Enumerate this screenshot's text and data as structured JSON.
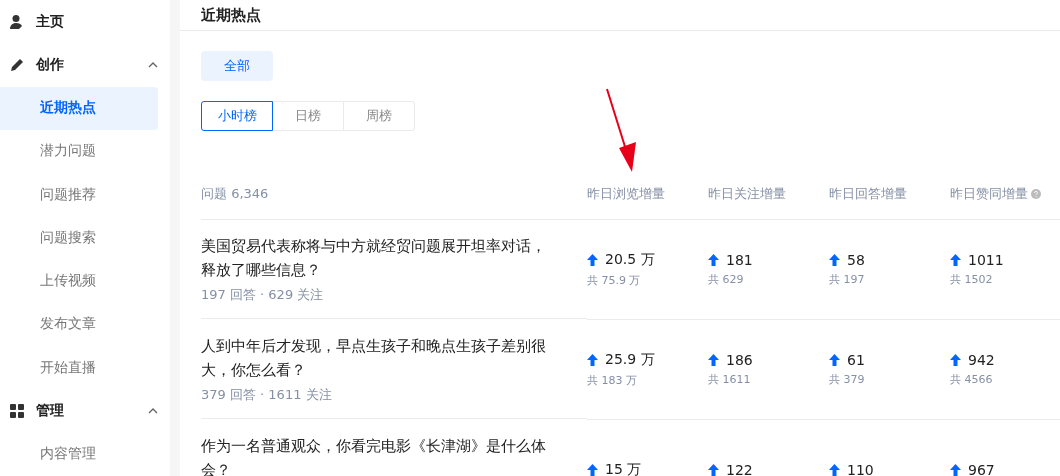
{
  "sidebar": [
    {
      "kind": "link",
      "label": "主页"
    },
    {
      "kind": "group",
      "label": "创作",
      "expanded": true,
      "children": [
        {
          "label": "近期热点",
          "selected": true
        },
        {
          "label": "潜力问题",
          "selected": false
        },
        {
          "label": "问题推荐",
          "selected": false
        },
        {
          "label": "问题搜索",
          "selected": false
        },
        {
          "label": "上传视频",
          "selected": false
        },
        {
          "label": "发布文章",
          "selected": false
        },
        {
          "label": "开始直播",
          "selected": false
        }
      ]
    },
    {
      "kind": "group",
      "label": "管理",
      "expanded": true,
      "children": [
        {
          "label": "内容管理",
          "selected": false
        }
      ]
    }
  ],
  "page_title": "近期热点",
  "filter_chips": [
    {
      "label": "全部",
      "selected": true
    }
  ],
  "range_tabs": [
    {
      "label": "小时榜",
      "selected": true
    },
    {
      "label": "日榜",
      "selected": false
    },
    {
      "label": "周榜",
      "selected": false
    }
  ],
  "table": {
    "question_header": "问题 6,346",
    "columns": [
      {
        "label": "昨日浏览增量",
        "help": false
      },
      {
        "label": "昨日关注增量",
        "help": false
      },
      {
        "label": "昨日回答增量",
        "help": false
      },
      {
        "label": "昨日赞同增量",
        "help": true
      }
    ],
    "rows": [
      {
        "title": "美国贸易代表称将与中方就经贸问题展开坦率对话，释放了哪些信息？",
        "meta": "197 回答 · 629 关注",
        "metrics": [
          {
            "value": "20.5 万",
            "total": "共 75.9 万"
          },
          {
            "value": "181",
            "total": "共 629"
          },
          {
            "value": "58",
            "total": "共 197"
          },
          {
            "value": "1011",
            "total": "共 1502"
          }
        ]
      },
      {
        "title": "人到中年后才发现，早点生孩子和晚点生孩子差别很大，你怎么看？",
        "meta": "379 回答 · 1611 关注",
        "metrics": [
          {
            "value": "25.9 万",
            "total": "共 183 万"
          },
          {
            "value": "186",
            "total": "共 1611"
          },
          {
            "value": "61",
            "total": "共 379"
          },
          {
            "value": "942",
            "total": "共 4566"
          }
        ]
      },
      {
        "title": "作为一名普通观众，你看完电影《长津湖》是什么体会？",
        "metrics": [
          {
            "value": "15 万"
          },
          {
            "value": "122"
          },
          {
            "value": "110"
          },
          {
            "value": "967"
          }
        ]
      }
    ]
  },
  "annotation": {
    "kind": "arrow"
  }
}
